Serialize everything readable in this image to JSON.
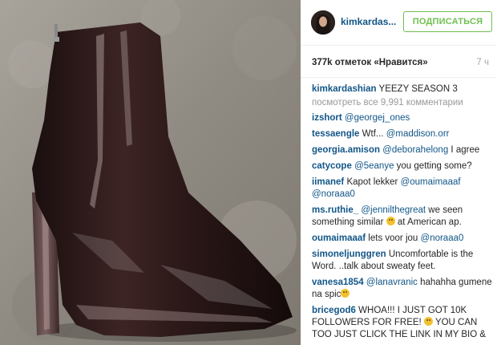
{
  "post": {
    "username": "kimkardas...",
    "follow_label": "ПОДПИСАТЬСЯ",
    "likes": "377k отметок «Нравится»",
    "time": "7 ч"
  },
  "comments": {
    "caption": {
      "user": "kimkardashian",
      "text": " YEEZY SEASON 3"
    },
    "view_all": "посмотреть все 9,991 комментарии",
    "items": [
      {
        "user": "izshort",
        "mention": "@georgej_ones"
      },
      {
        "user": "tessaengle",
        "text": " Wtf... ",
        "mention": "@maddison.orr"
      },
      {
        "user": "georgia.amison",
        "mention": "@deborahelong",
        "after": " I agree"
      },
      {
        "user": "catycope",
        "mention": "@5eanye",
        "after": " you getting some?"
      },
      {
        "user": "iimanef",
        "text": " Kapot lekker ",
        "mention": "@oumaimaaaf",
        "mention2": "@noraaa0"
      },
      {
        "user": "ms.ruthie_",
        "mention": "@jennilthegreat",
        "after": " we seen something similar",
        "after2": " at American ap."
      },
      {
        "user": "oumaimaaaf",
        "text": " lets voor jou ",
        "mention": "@noraaa0"
      },
      {
        "user": "simoneljunggren",
        "text": " Uncomfortable is the Word. ..talk about sweaty feet."
      },
      {
        "user": "vanesa1854",
        "mention": "@lanavranic",
        "after": " hahahha gumene na spic"
      },
      {
        "user": "bricegod6",
        "text": " WHOA!!! I JUST GOT 10K FOLLOWERS FOR FREE!",
        "after": " YOU CAN TOO JUST CLICK THE LINK IN MY BIO &"
      }
    ]
  },
  "icons": {
    "avatar": "avatar",
    "emoji": "emoji-icon"
  },
  "colors": {
    "link": "#125688",
    "follow": "#70c050",
    "muted": "#999999"
  }
}
